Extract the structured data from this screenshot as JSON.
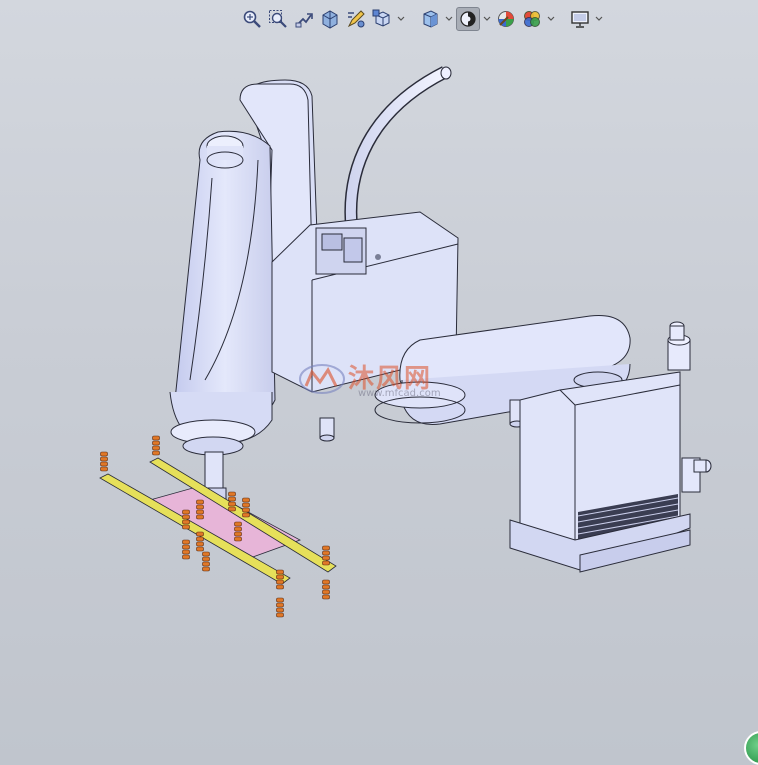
{
  "toolbar": {
    "buttons": [
      {
        "icon": "zoom-to-fit-icon",
        "active": false
      },
      {
        "icon": "zoom-to-area-icon",
        "active": false
      },
      {
        "icon": "previous-view-icon",
        "active": false
      },
      {
        "icon": "section-view-icon",
        "active": false
      },
      {
        "icon": "dynamic-annotation-icon",
        "active": false
      },
      {
        "icon": "view-orientation-icon",
        "active": false,
        "dropdown": true
      },
      {
        "icon": "display-style-icon",
        "active": false,
        "dropdown": true
      },
      {
        "icon": "hide-show-items-icon",
        "active": true,
        "dropdown": true
      },
      {
        "icon": "edit-appearance-icon",
        "active": false
      },
      {
        "icon": "apply-scene-icon",
        "active": false,
        "dropdown": true
      },
      {
        "icon": "view-settings-icon",
        "active": false,
        "dropdown": true
      }
    ]
  },
  "watermark": {
    "text": "沐风网",
    "sub": "www.mfcad.com"
  },
  "colors": {
    "robot_body": "#dfe3f7",
    "robot_edge": "#2a2c3a",
    "gripper_bar": "#e6e05a",
    "gripper_pins": "#e07828",
    "gripper_plate": "#e7b5d8",
    "background": "#c9cdd5"
  }
}
